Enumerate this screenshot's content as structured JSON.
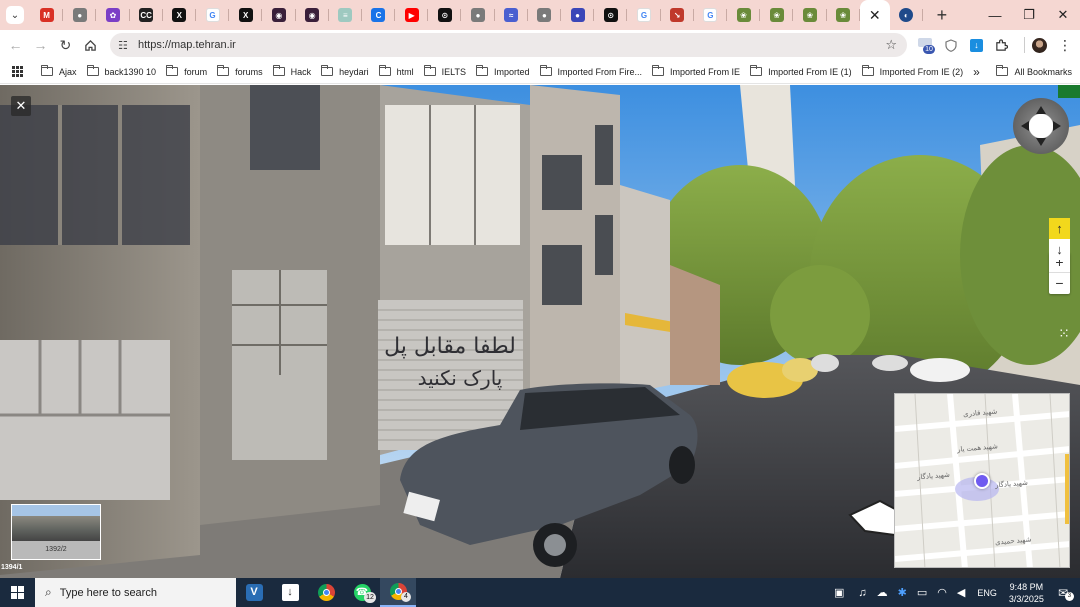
{
  "browser": {
    "tabs": [
      {
        "icon": "gmail-icon",
        "color": "#d93025",
        "glyph": "M"
      },
      {
        "icon": "globe-icon",
        "color": "#7a7a7a",
        "glyph": "●"
      },
      {
        "icon": "flower-icon",
        "color": "#7b3fc6",
        "glyph": "✿"
      },
      {
        "icon": "cc-icon",
        "color": "#222222",
        "glyph": "CC"
      },
      {
        "icon": "x-logo-icon",
        "color": "#111111",
        "glyph": "X"
      },
      {
        "icon": "google-icon",
        "color": "#ffffff",
        "glyph": "G"
      },
      {
        "icon": "x-logo-icon",
        "color": "#111111",
        "glyph": "X"
      },
      {
        "icon": "dark-app-icon",
        "color": "#3a1f3a",
        "glyph": "◉"
      },
      {
        "icon": "dark-app-icon",
        "color": "#3a1f3a",
        "glyph": "◉"
      },
      {
        "icon": "grid-site-icon",
        "color": "#9ec9c0",
        "glyph": "≡"
      },
      {
        "icon": "c-logo-icon",
        "color": "#1a73e8",
        "glyph": "C"
      },
      {
        "icon": "youtube-icon",
        "color": "#ff0000",
        "glyph": "▶"
      },
      {
        "icon": "openai-icon",
        "color": "#111111",
        "glyph": "⊙"
      },
      {
        "icon": "globe-icon",
        "color": "#7a7a7a",
        "glyph": "●"
      },
      {
        "icon": "wave-icon",
        "color": "#4a5fd0",
        "glyph": "≈"
      },
      {
        "icon": "globe-icon",
        "color": "#7a7a7a",
        "glyph": "●"
      },
      {
        "icon": "blue-circle-icon",
        "color": "#3b46b8",
        "glyph": "●"
      },
      {
        "icon": "openai-icon",
        "color": "#111111",
        "glyph": "⊙"
      },
      {
        "icon": "google-icon",
        "color": "#ffffff",
        "glyph": "G"
      },
      {
        "icon": "zigzag-icon",
        "color": "#c0392b",
        "glyph": "↘"
      },
      {
        "icon": "google-icon",
        "color": "#ffffff",
        "glyph": "G"
      },
      {
        "icon": "emblem-icon",
        "color": "#6a8b3a",
        "glyph": "❀"
      },
      {
        "icon": "emblem-icon",
        "color": "#6a8b3a",
        "glyph": "❀"
      },
      {
        "icon": "emblem-icon",
        "color": "#6a8b3a",
        "glyph": "❀"
      },
      {
        "icon": "emblem-icon",
        "color": "#6a8b3a",
        "glyph": "❀"
      }
    ],
    "active_tab_close": "✕",
    "after_tab_icon": {
      "icon": "map-site-icon",
      "color": "#1f4a8a",
      "glyph": "◐"
    },
    "new_tab": "+",
    "window_controls": {
      "minimize": "—",
      "maximize": "❐",
      "close": "✕"
    },
    "url": "https://map.tehran.ir",
    "extension_badge": "10",
    "bookmarks": [
      {
        "label": "Ajax"
      },
      {
        "label": "back1390 10"
      },
      {
        "label": "forum"
      },
      {
        "label": "forums"
      },
      {
        "label": "Hack"
      },
      {
        "label": "heydari"
      },
      {
        "label": "html"
      },
      {
        "label": "IELTS"
      },
      {
        "label": "Imported"
      },
      {
        "label": "Imported From Fire..."
      },
      {
        "label": "Imported From IE"
      },
      {
        "label": "Imported From IE (1)"
      },
      {
        "label": "Imported From IE (2)"
      }
    ],
    "bookmarks_more": "»",
    "all_bookmarks": "All Bookmarks"
  },
  "streetview": {
    "close": "✕",
    "zoom_in": "+",
    "zoom_out": "−",
    "up_arrow": "↑",
    "down_arrow": "↓",
    "drag_handle": "⁙",
    "thumbnail_label": "1392/2",
    "year_label": "1394/1",
    "shop_graffiti": "لطفا مقابل پل",
    "shop_graffiti_2": "پارک نکنید",
    "minimap": {
      "street_labels": [
        "شهید قادری",
        "شهید همت یار",
        "شهید یادگار",
        "شهید حمیدی"
      ]
    }
  },
  "taskbar": {
    "search_placeholder": "Type here to search",
    "whatsapp_badge": "12",
    "chrome_badge": "4",
    "language": "ENG",
    "time": "9:48 PM",
    "date": "3/3/2025",
    "notification_count": "3"
  }
}
